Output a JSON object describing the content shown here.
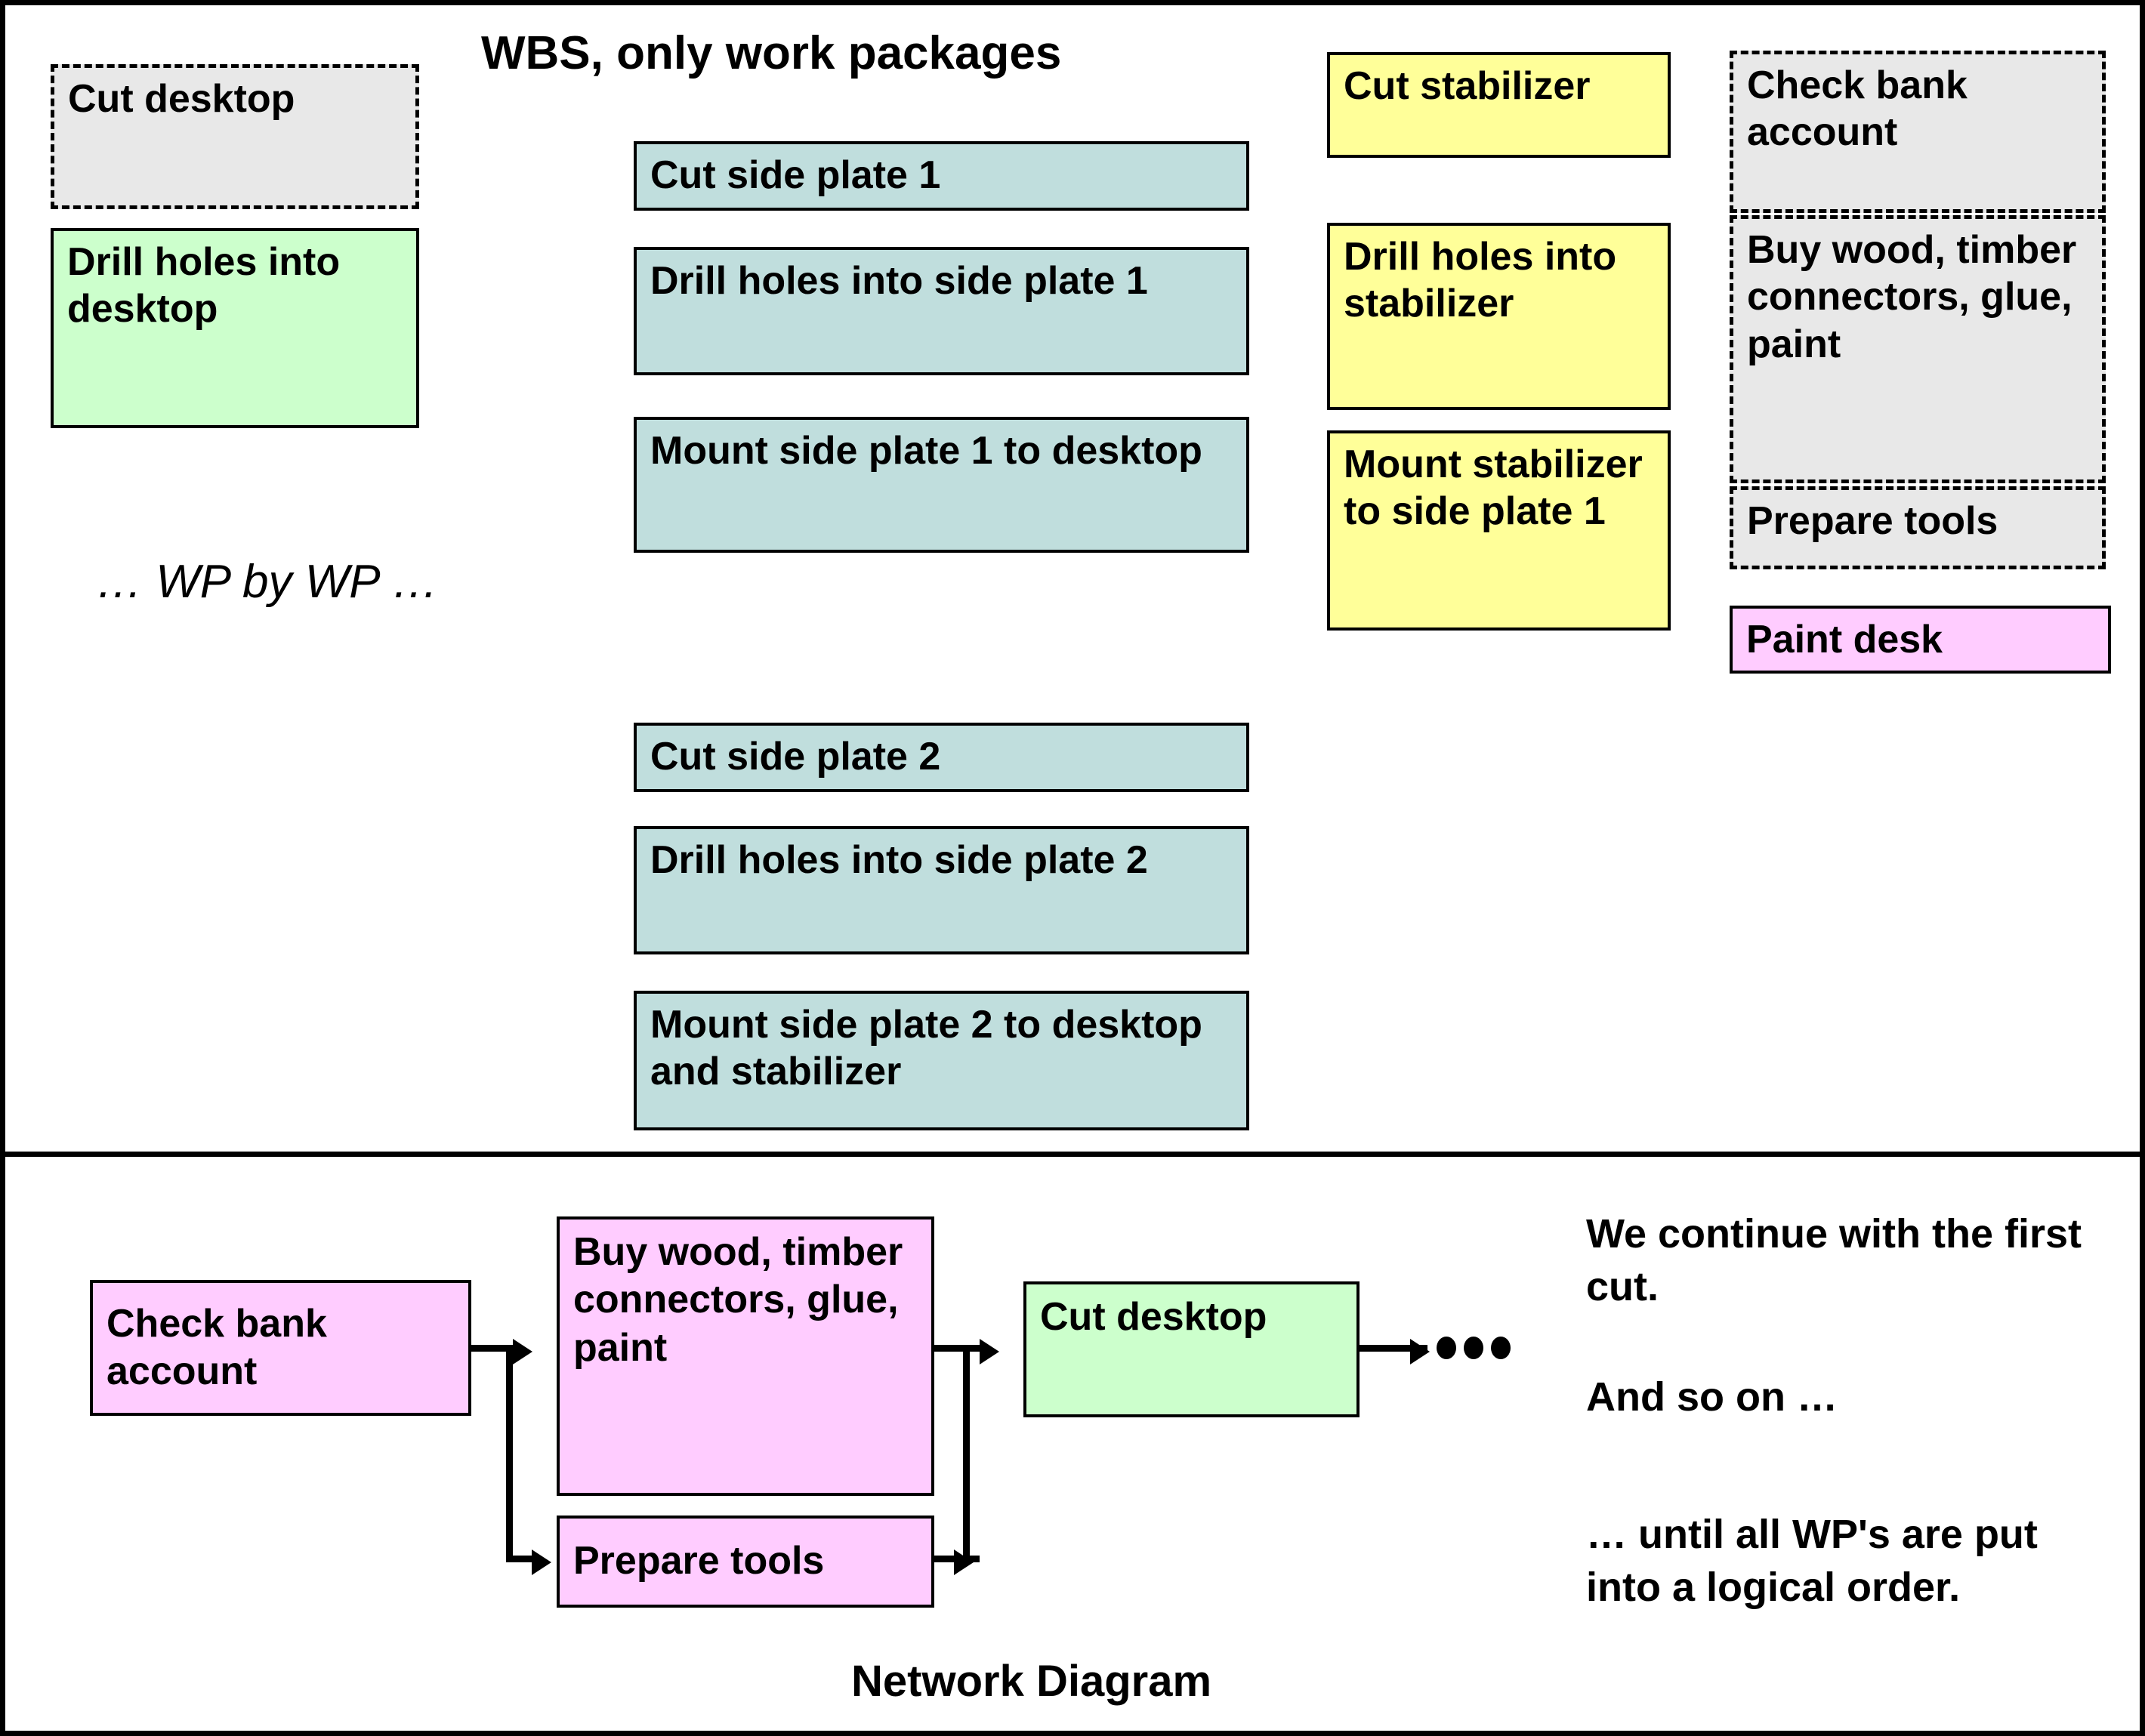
{
  "wbs": {
    "title": "WBS, only work packages",
    "ellipsis_note": "… WP by WP …",
    "column1": [
      {
        "label": "Cut desktop",
        "color": "gray",
        "style": "dashed"
      },
      {
        "label": "Drill holes into desktop",
        "color": "green",
        "style": "solid"
      }
    ],
    "column2": [
      {
        "label": "Cut side plate 1",
        "color": "blue",
        "style": "solid"
      },
      {
        "label": "Drill holes into side plate 1",
        "color": "blue",
        "style": "solid"
      },
      {
        "label": "Mount side plate 1 to desktop",
        "color": "blue",
        "style": "solid"
      },
      {
        "label": "Cut side plate 2",
        "color": "blue",
        "style": "solid"
      },
      {
        "label": "Drill holes into side plate 2",
        "color": "blue",
        "style": "solid"
      },
      {
        "label": "Mount side plate 2 to desktop and stabilizer",
        "color": "blue",
        "style": "solid"
      }
    ],
    "column3": [
      {
        "label": "Cut stabilizer",
        "color": "yellow",
        "style": "solid"
      },
      {
        "label": "Drill holes into stabilizer",
        "color": "yellow",
        "style": "solid"
      },
      {
        "label": "Mount stabilizer to side plate 1",
        "color": "yellow",
        "style": "solid"
      }
    ],
    "column4": [
      {
        "label": "Check bank account",
        "color": "gray",
        "style": "dashed"
      },
      {
        "label": "Buy wood, timber connectors, glue, paint",
        "color": "gray",
        "style": "dashed"
      },
      {
        "label": "Prepare tools",
        "color": "gray",
        "style": "dashed"
      },
      {
        "label": "Paint desk",
        "color": "pink",
        "style": "solid"
      }
    ]
  },
  "network": {
    "caption": "Network Diagram",
    "nodes": {
      "check_bank_account": "Check bank account",
      "buy_wood": "Buy wood, timber connectors, glue, paint",
      "prepare_tools": "Prepare tools",
      "cut_desktop": "Cut desktop"
    },
    "continuation": "…",
    "notes": [
      "We continue with the first cut.",
      "And so on …",
      "… until all WP's are put into a logical order."
    ]
  },
  "colors": {
    "gray": "#e8e8e8",
    "green": "#ccffcc",
    "blue": "#c0dedd",
    "yellow": "#ffff99",
    "pink": "#ffccff",
    "stroke": "#000000",
    "background": "#ffffff"
  }
}
